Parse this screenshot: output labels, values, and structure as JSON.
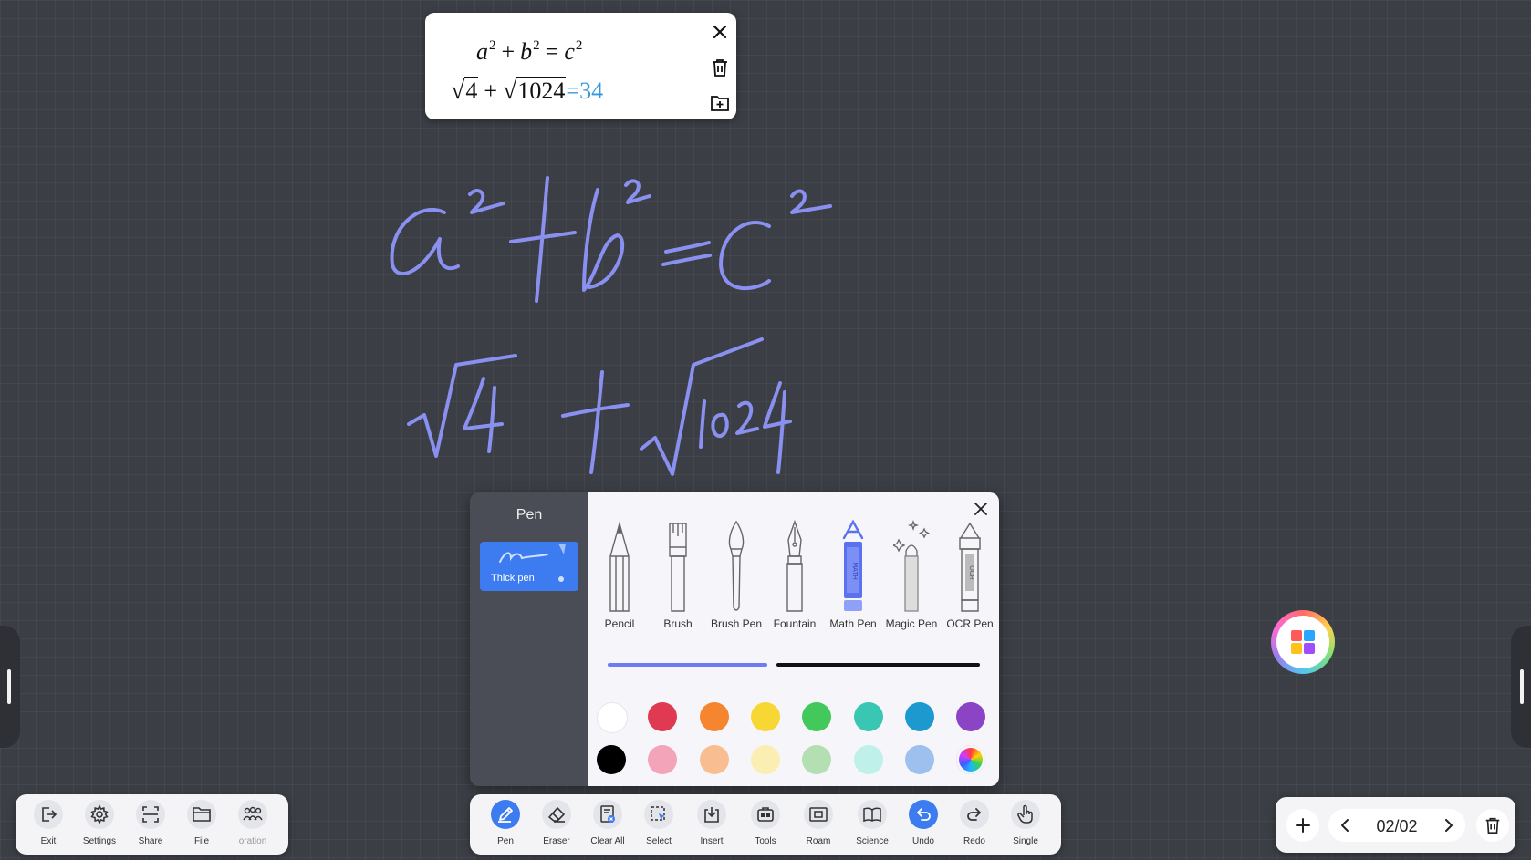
{
  "math_card": {
    "equation_vars": [
      "a",
      "b",
      "c"
    ],
    "exponent": "2",
    "plus": "+",
    "equals": "=",
    "radicand_1": "4",
    "radicand_2": "1024",
    "result": "=34",
    "result_color": "#3399dd"
  },
  "handwriting": {
    "ink_color": "#8a90f0"
  },
  "pen_panel": {
    "title": "Pen",
    "thick_pen_label": "Thick pen",
    "tools": [
      {
        "name": "pencil",
        "label": "Pencil",
        "icon": "pencil-icon"
      },
      {
        "name": "brush",
        "label": "Brush",
        "icon": "brush-icon"
      },
      {
        "name": "brush-pen",
        "label": "Brush Pen",
        "icon": "brush-pen-icon"
      },
      {
        "name": "fountain",
        "label": "Fountain",
        "icon": "fountain-pen-icon"
      },
      {
        "name": "math-pen",
        "label": "Math Pen",
        "icon": "math-pen-icon",
        "selected": true
      },
      {
        "name": "magic-pen",
        "label": "Magic Pen",
        "icon": "magic-pen-icon"
      },
      {
        "name": "ocr-pen",
        "label": "OCR Pen",
        "icon": "ocr-pen-icon"
      }
    ],
    "thickness_level": 0.43,
    "accent": "#6b7cf5",
    "colors_row1": [
      "#ffffff",
      "#e03a52",
      "#f5852e",
      "#f7d733",
      "#43c85c",
      "#39c6b3",
      "#1c9ad0",
      "#8a44c4"
    ],
    "colors_row2": [
      "#000000",
      "#f4a4b8",
      "#f8be92",
      "#fbeeb2",
      "#b3dfb3",
      "#bff0ea",
      "#9ec0ee",
      "rainbow"
    ]
  },
  "toolbar_left": {
    "items": [
      {
        "label": "Exit",
        "icon": "exit-icon"
      },
      {
        "label": "Settings",
        "icon": "gear-icon"
      },
      {
        "label": "Share",
        "icon": "share-icon"
      },
      {
        "label": "File",
        "icon": "folder-icon"
      },
      {
        "label": "oration",
        "icon": "collaboration-icon"
      }
    ]
  },
  "toolbar_center": {
    "items": [
      {
        "label": "Pen",
        "icon": "pen-icon",
        "active": true
      },
      {
        "label": "Eraser",
        "icon": "eraser-icon"
      },
      {
        "label": "Clear All",
        "icon": "clear-all-icon"
      },
      {
        "label": "Select",
        "icon": "select-icon"
      },
      {
        "label": "Insert",
        "icon": "insert-icon"
      },
      {
        "label": "Tools",
        "icon": "tools-icon"
      },
      {
        "label": "Roam",
        "icon": "roam-icon"
      },
      {
        "label": "Science",
        "icon": "science-icon"
      },
      {
        "label": "Undo",
        "icon": "undo-icon",
        "active": true
      },
      {
        "label": "Redo",
        "icon": "redo-icon"
      },
      {
        "label": "Single",
        "icon": "hand-icon"
      }
    ]
  },
  "page_nav": {
    "page_indicator": "02/02"
  }
}
